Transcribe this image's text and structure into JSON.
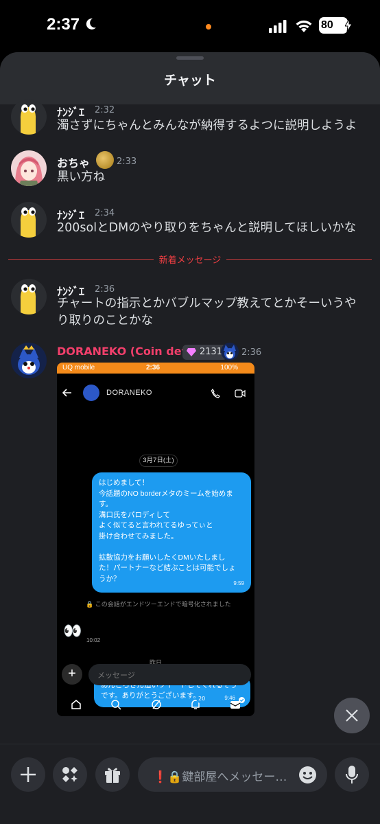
{
  "status_bar": {
    "time": "2:37",
    "battery": "80"
  },
  "header": {
    "title": "チャット"
  },
  "messages": [
    {
      "user": "ﾅﾝｼﾞｴ",
      "time": "2:32",
      "lines": [
        "濁さずにちゃんとみんなが納得するよつに説明しようよ"
      ]
    },
    {
      "user": "おちゃ",
      "time": "2:33",
      "lines": [
        "黒い方ね"
      ]
    },
    {
      "user": "ﾅﾝｼﾞｴ",
      "time": "2:34",
      "lines": [
        "200solとDMのやり取りをちゃんと説明してほしいかな"
      ]
    },
    {
      "user": "ﾅﾝｼﾞｴ",
      "time": "2:36",
      "lines": [
        "チャートの指示とかバブルマップ教えてとかそーいうや",
        "り取りのことかな"
      ]
    },
    {
      "user": "DORANEKO (Coin dev)",
      "time": "2:36",
      "boost_count": "2131"
    }
  ],
  "new_messages_divider": "新着メッセージ",
  "attachment": {
    "status": {
      "carrier": "UQ mobile",
      "time": "2:36",
      "battery": "100%"
    },
    "contact": "DORANEKO",
    "date_pill": "3月7日(土)",
    "bubble_lines": [
      "はじめまして！",
      "今話題のNO borderメタのミームを始めま",
      "す。",
      "溝口氏をパロディして",
      "よく似てると言われてるゆってぃと",
      "掛け合わせてみました。",
      "",
      "拡散協力をお願いしたくDMいたしまし",
      "た！パートナーなど結ぶことは可能でしょ",
      "うか？"
    ],
    "bubble_time": "9:59",
    "encryption_note": "この会話がエンドツーエンドで暗号化されました",
    "eyes_time": "10:02",
    "day_label": "昨日",
    "reply_lines": [
      "あんころさん追いツイートしてくれるそう",
      "です。ありがとうございます。"
    ],
    "reply_time": "9:46",
    "input_placeholder": "メッセージ",
    "notification_count": "20"
  },
  "composer": {
    "placeholder": "鍵部屋へメッセー…"
  },
  "colors": {
    "accent_red": "#f23f43",
    "dm_blue": "#1d9bf0",
    "dev_name": "#f23f6b"
  }
}
